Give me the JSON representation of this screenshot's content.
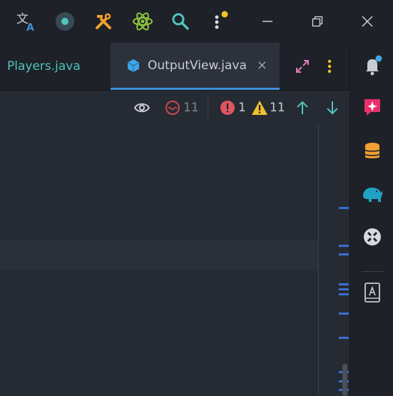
{
  "titlebar": {
    "icons": [
      "translate-icon",
      "record-icon",
      "build-tools-icon",
      "atom-icon",
      "search-icon",
      "more-menu-icon"
    ],
    "window_controls": [
      "minimize-icon",
      "restore-icon",
      "close-icon"
    ]
  },
  "tabs": [
    {
      "label": "Players.java",
      "active": false
    },
    {
      "label": "OutputView.java",
      "active": true,
      "close": "×"
    }
  ],
  "inspection": {
    "spelling_count": "11",
    "error_count": "1",
    "warning_count": "11"
  },
  "colors": {
    "accent": "#3d8fd6",
    "error": "#e05561",
    "warning": "#f0c32b",
    "tab_inactive_text": "#4fc4bf"
  }
}
